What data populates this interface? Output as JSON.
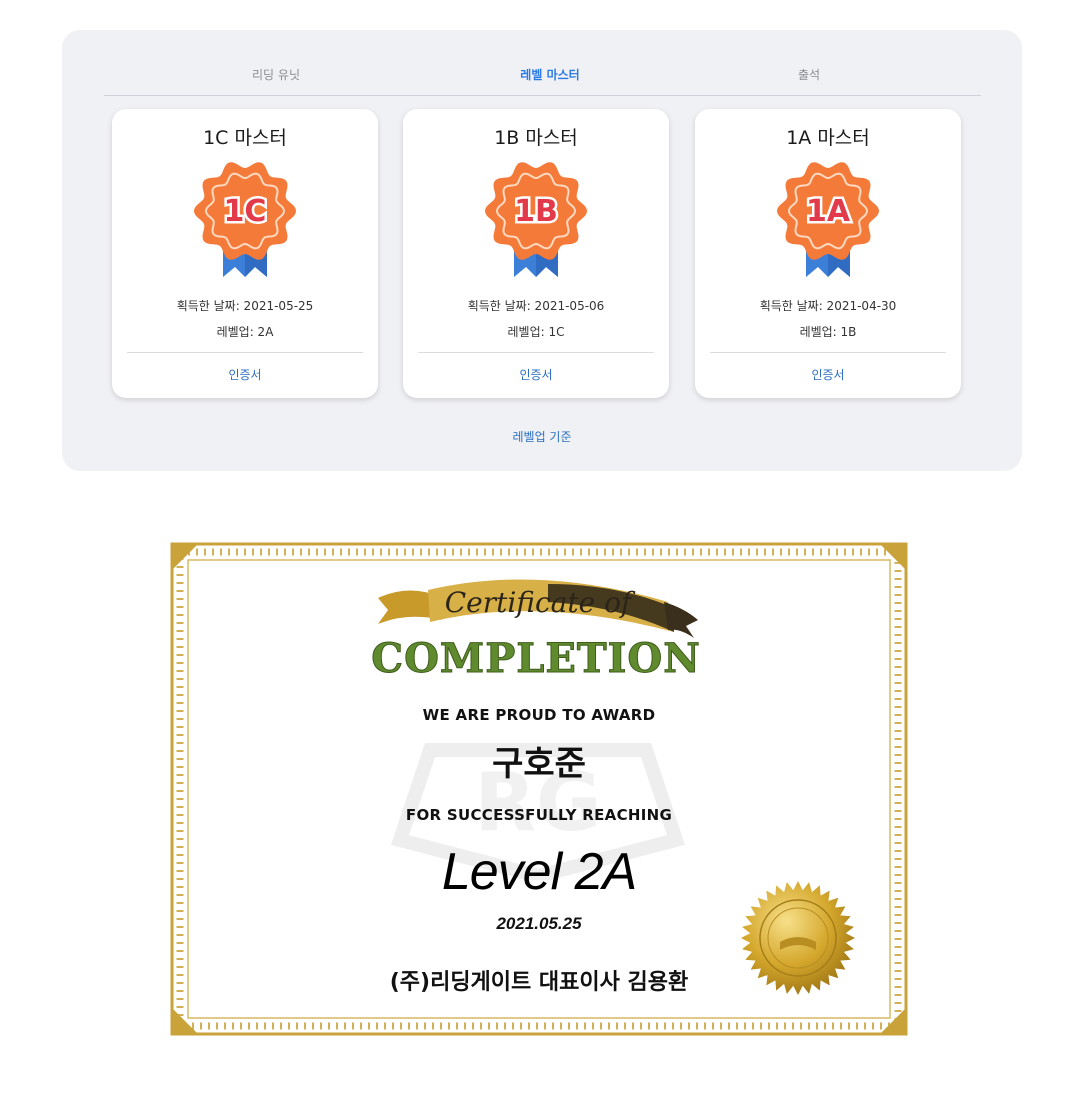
{
  "tabs": [
    {
      "label": "리딩 유닛",
      "active": false
    },
    {
      "label": "레벨 마스터",
      "active": true
    },
    {
      "label": "출석",
      "active": false
    }
  ],
  "cards": [
    {
      "title": "1C 마스터",
      "badge_text": "1C",
      "date": "획득한 날짜: 2021-05-25",
      "levelup": "레벨업: 2A",
      "link": "인증서"
    },
    {
      "title": "1B 마스터",
      "badge_text": "1B",
      "date": "획득한 날짜: 2021-05-06",
      "levelup": "레벨업: 1C",
      "link": "인증서"
    },
    {
      "title": "1A 마스터",
      "badge_text": "1A",
      "date": "획득한 날짜: 2021-04-30",
      "levelup": "레벨업: 1B",
      "link": "인증서"
    }
  ],
  "criteria_link": "레벨업 기준",
  "certificate": {
    "header_script": "Certificate of",
    "header_title": "COMPLETION",
    "line1": "WE ARE PROUD TO AWARD",
    "name": "구호준",
    "line2": "FOR SUCCESSFULLY REACHING",
    "level": "Level 2A",
    "date": "2021.05.25",
    "signer": "(주)리딩게이트 대표이사 김용환"
  },
  "colors": {
    "accent": "#2c7be5",
    "link": "#2c6fbf",
    "badge_orange": "#f47a3a",
    "badge_ribbon": "#3b7fd9",
    "badge_text": "#e23a4a",
    "gold": "#c9a23a",
    "completion_green": "#5f8a2e"
  },
  "icons": {
    "badge": "rosette-badge-icon",
    "seal": "gold-seal-icon"
  }
}
